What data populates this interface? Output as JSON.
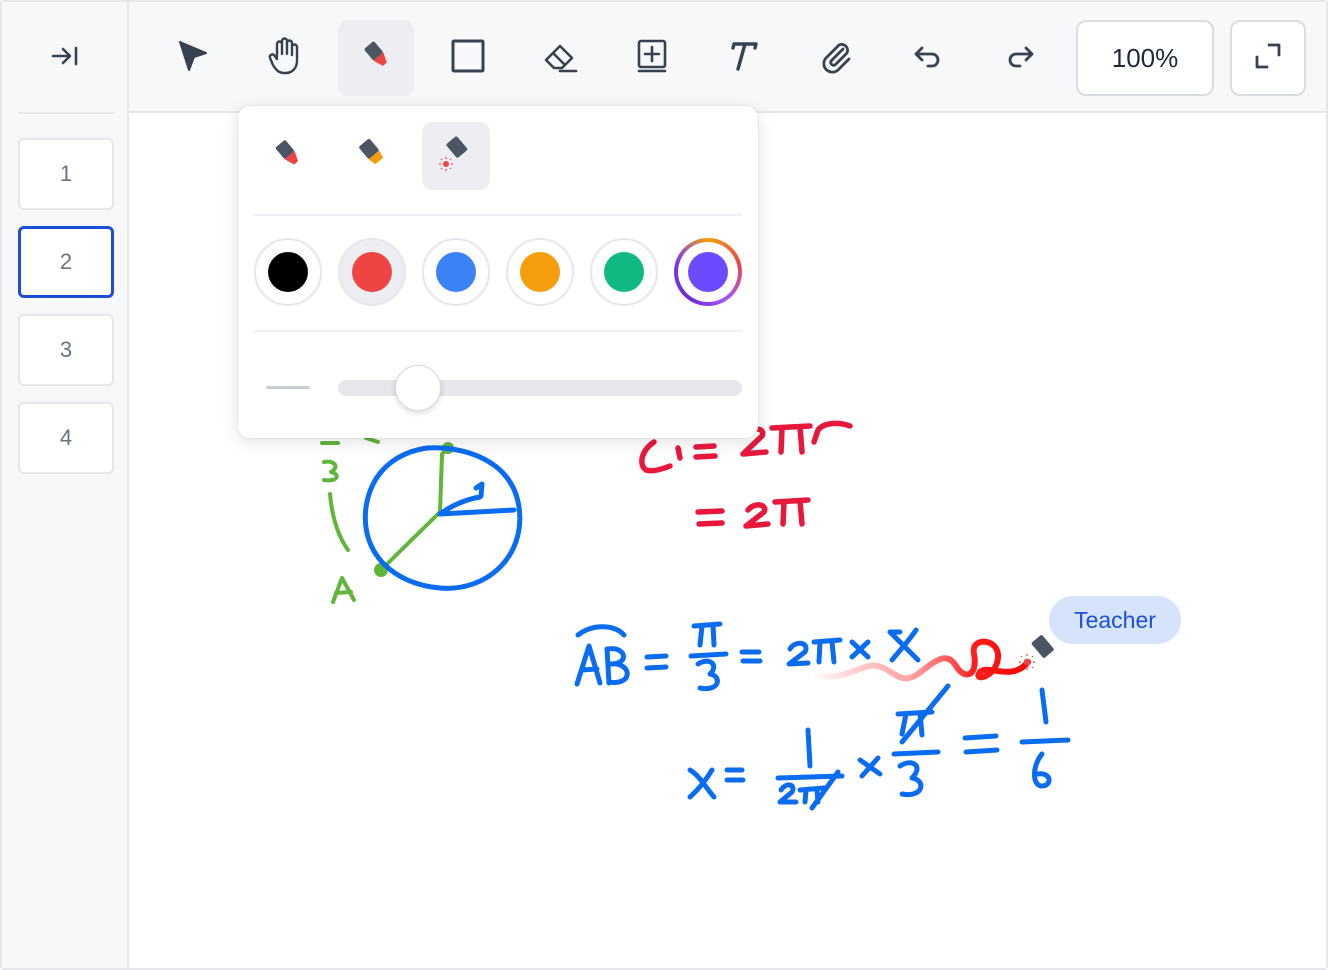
{
  "sidebar": {
    "collapse_icon": "collapse-right-icon",
    "pages": [
      {
        "label": "1",
        "active": false
      },
      {
        "label": "2",
        "active": true
      },
      {
        "label": "3",
        "active": false
      },
      {
        "label": "4",
        "active": false
      }
    ]
  },
  "toolbar": {
    "tools": [
      {
        "name": "select",
        "icon": "pointer-icon",
        "active": false
      },
      {
        "name": "pan",
        "icon": "hand-icon",
        "active": false
      },
      {
        "name": "pen",
        "icon": "pen-icon",
        "active": true
      },
      {
        "name": "shape",
        "icon": "square-icon",
        "active": false
      },
      {
        "name": "eraser",
        "icon": "eraser-icon",
        "active": false
      },
      {
        "name": "add-page",
        "icon": "add-box-icon",
        "active": false
      },
      {
        "name": "text",
        "icon": "text-icon",
        "active": false
      },
      {
        "name": "attach",
        "icon": "paperclip-icon",
        "active": false
      },
      {
        "name": "undo",
        "icon": "undo-icon",
        "active": false
      },
      {
        "name": "redo",
        "icon": "redo-icon",
        "active": false
      }
    ],
    "zoom_label": "100%",
    "fullscreen_icon": "fullscreen-icon"
  },
  "pen_popover": {
    "pen_types": [
      {
        "name": "marker",
        "icon": "marker-icon",
        "active": false
      },
      {
        "name": "highlighter",
        "icon": "highlighter-icon",
        "active": false
      },
      {
        "name": "laser",
        "icon": "laser-pointer-icon",
        "active": true
      }
    ],
    "colors": [
      {
        "name": "black",
        "hex": "#000000"
      },
      {
        "name": "red",
        "hex": "#ef4444",
        "selected": true
      },
      {
        "name": "blue",
        "hex": "#3b82f6"
      },
      {
        "name": "orange",
        "hex": "#f59e0b"
      },
      {
        "name": "green",
        "hex": "#10b981"
      },
      {
        "name": "custom",
        "hex": "#6d4aff"
      }
    ],
    "thickness_fraction": 0.16
  },
  "canvas": {
    "cursor_label": "Teacher",
    "ink_colors": {
      "blue": "#0a6cf0",
      "green": "#5fb63a",
      "red": "#e8173c"
    }
  }
}
